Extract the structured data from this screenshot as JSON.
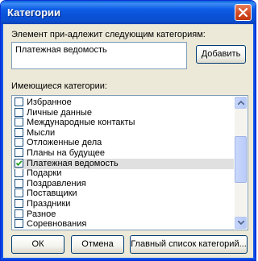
{
  "window": {
    "title": "Категории",
    "close_icon": "close-icon"
  },
  "assigned": {
    "label": "Элемент при-адлежит следующим категориям:",
    "value": "Платежная ведомость",
    "add_button": "Добавить"
  },
  "available": {
    "label": "Имеющиеся категории:",
    "items": [
      {
        "label": "Избранное",
        "checked": false
      },
      {
        "label": "Личные данные",
        "checked": false
      },
      {
        "label": "Международные контакты",
        "checked": false
      },
      {
        "label": "Мысли",
        "checked": false
      },
      {
        "label": "Отложенные дела",
        "checked": false
      },
      {
        "label": "Планы на будущее",
        "checked": false
      },
      {
        "label": "Платежная ведомость",
        "checked": true
      },
      {
        "label": "Подарки",
        "checked": false
      },
      {
        "label": "Поздравления",
        "checked": false
      },
      {
        "label": "Поставщики",
        "checked": false
      },
      {
        "label": "Праздники",
        "checked": false
      },
      {
        "label": "Разное",
        "checked": false
      },
      {
        "label": "Соревнования",
        "checked": false
      }
    ]
  },
  "buttons": {
    "ok": "ОК",
    "cancel": "Отмена",
    "master_list": "Главный список категорий..."
  }
}
